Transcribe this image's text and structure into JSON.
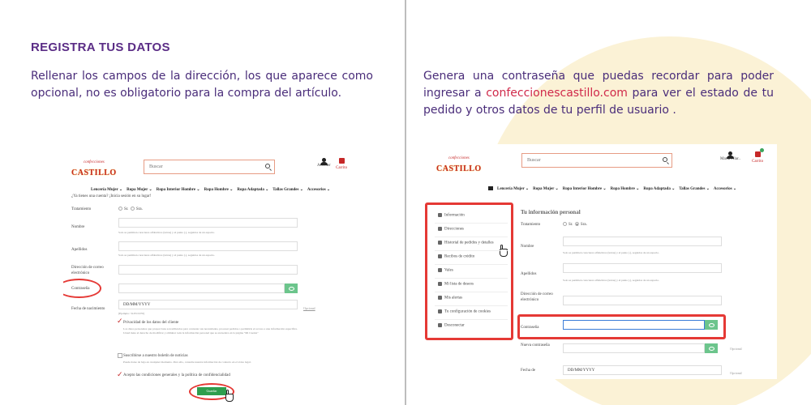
{
  "left_panel": {
    "heading": "REGISTRA TUS DATOS",
    "text": "Rellenar los campos de la dirección, los que aparece como opcional, no es obligatorio para la compra del artículo.",
    "screenshot": {
      "logo_small": "confecciones",
      "logo_big": "CASTILLO",
      "search_placeholder": "Buscar",
      "account_label": "Acceder",
      "cart_label": "Carrito",
      "nav": [
        "Lencería Mujer ⌄",
        "Ropa Mujer ⌄",
        "Ropa Interior Hombre ⌄",
        "Ropa Hombre ⌄",
        "Ropa Adaptada ⌄",
        "Tallas Grandes ⌄",
        "Accesorios ⌄"
      ],
      "login_prompt": "¿Ya tienes una cuenta? ¡Inicia sesión en su lugar!",
      "title_label": "Tratamiento",
      "title_options": [
        "Sr.",
        "Sra."
      ],
      "name_label": "Nombre",
      "name_help": "Solo se permiten caracteres alfabéticos (letras) y el punto (.), seguidos de un espacio.",
      "surname_label": "Apellidos",
      "surname_help": "Solo se permiten caracteres alfabéticos (letras) y el punto (.), seguidos de un espacio.",
      "email_label": "Dirección de correo electrónico",
      "password_label": "Contraseña",
      "birthdate_label": "Fecha de nacimiento",
      "birthdate_value": "DD/MM/YYYY",
      "birthdate_example": "(Ejemplo: 31/05/1970)",
      "optional": "Opcional",
      "privacy_label": "Privacidad de los datos del cliente",
      "privacy_text": "Los datos personales que proporciona son utilizados para contestar sus necesidades, procesar pedidos o permitirle el acceso a una información específica. Usted tiene el derecho de modificar y eliminar toda la información personal que se encuentra en la página \"Mi Cuenta\"",
      "newsletter_label": "Suscribirse a nuestro boletín de noticias",
      "newsletter_text": "Puede darse de baja en cualquier momento. Para ello, consulte nuestra información de contacto en el aviso legal.",
      "terms_label": "Acepto las condiciones generales y la política de confidencialidad",
      "save_button": "Guardar"
    }
  },
  "right_panel": {
    "text_before": "Genera una contraseña que puedas recordar para poder ingresar a ",
    "link": "confeccionescastillo.com",
    "text_after": " para ver el estado de tu pedido y otros datos de tu perfil de usuario .",
    "screenshot": {
      "logo_small": "confecciones",
      "logo_big": "CASTILLO",
      "search_placeholder": "Buscar",
      "account_label": "María Pilar..",
      "cart_label": "Carrito",
      "cart_count": "0",
      "nav": [
        "Lencería Mujer ⌄",
        "Ropa Mujer ⌄",
        "Ropa Interior Hombre ⌄",
        "Ropa Hombre ⌄",
        "Ropa Adaptada ⌄",
        "Tallas Grandes ⌄",
        "Accesorios ⌄"
      ],
      "menu": [
        "Información",
        "Direcciones",
        "Historial de pedidos y detalles",
        "Recibos de crédito",
        "Vales",
        "Mi lista de deseos",
        "Mis alertas",
        "Tu configuración de cookies",
        "Desconectar"
      ],
      "section_title": "Tu información personal",
      "title_label": "Tratamiento",
      "title_options": [
        "Sr.",
        "Sra."
      ],
      "name_label": "Nombre",
      "name_help": "Solo se permiten caracteres alfabéticos (letras) y el punto (.), seguidos de un espacio.",
      "surname_label": "Apellidos",
      "surname_help": "Solo se permiten caracteres alfabéticos (letras) y el punto (.), seguidos de un espacio.",
      "email_label": "Dirección de correo electrónico",
      "password_label": "Contraseña",
      "new_password_label": "Nueva contraseña",
      "optional": "Opcional",
      "birthdate_label": "Fecha de",
      "birthdate_value": "DD/MM/YYYY"
    }
  },
  "colors": {
    "heading": "#5b2d86",
    "body_text": "#4a2d7a",
    "link": "#d0294a",
    "highlight": "#e53935",
    "button": "#2e9e4e"
  }
}
